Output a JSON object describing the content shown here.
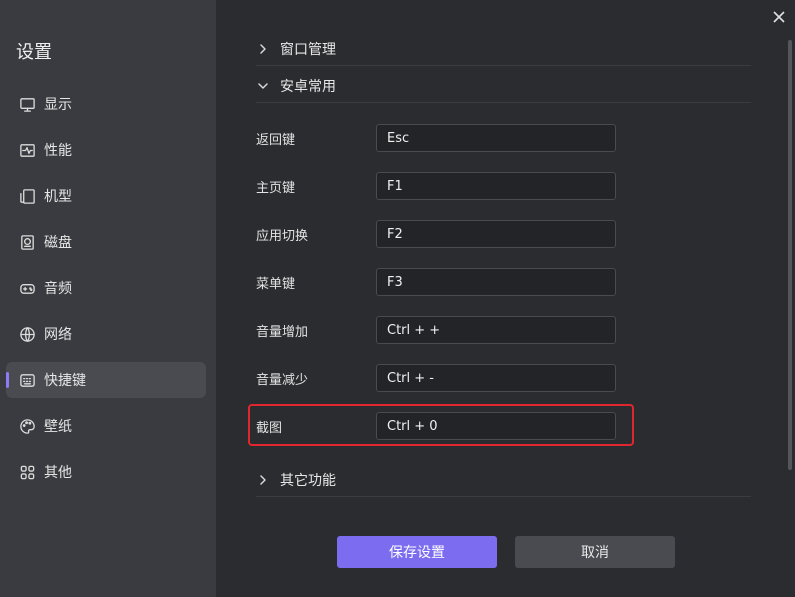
{
  "sidebar": {
    "title": "设置",
    "items": [
      {
        "label": "显示",
        "icon": "monitor-icon",
        "active": false
      },
      {
        "label": "性能",
        "icon": "activity-icon",
        "active": false
      },
      {
        "label": "机型",
        "icon": "device-icon",
        "active": false
      },
      {
        "label": "磁盘",
        "icon": "disk-icon",
        "active": false
      },
      {
        "label": "音频",
        "icon": "gamepad-icon",
        "active": false
      },
      {
        "label": "网络",
        "icon": "globe-icon",
        "active": false
      },
      {
        "label": "快捷键",
        "icon": "keyboard-icon",
        "active": true
      },
      {
        "label": "壁纸",
        "icon": "palette-icon",
        "active": false
      },
      {
        "label": "其他",
        "icon": "grid-icon",
        "active": false
      }
    ]
  },
  "sections": {
    "window_management": "窗口管理",
    "android_common": "安卓常用",
    "other_features": "其它功能"
  },
  "shortcuts": [
    {
      "label": "返回键",
      "value": "Esc"
    },
    {
      "label": "主页键",
      "value": "F1"
    },
    {
      "label": "应用切换",
      "value": "F2"
    },
    {
      "label": "菜单键",
      "value": "F3"
    },
    {
      "label": "音量增加",
      "value": "Ctrl + +"
    },
    {
      "label": "音量减少",
      "value": "Ctrl + -"
    },
    {
      "label": "截图",
      "value": "Ctrl + 0"
    }
  ],
  "buttons": {
    "save": "保存设置",
    "cancel": "取消"
  },
  "colors": {
    "accent": "#7b6cf0",
    "highlight": "#e0262e"
  }
}
